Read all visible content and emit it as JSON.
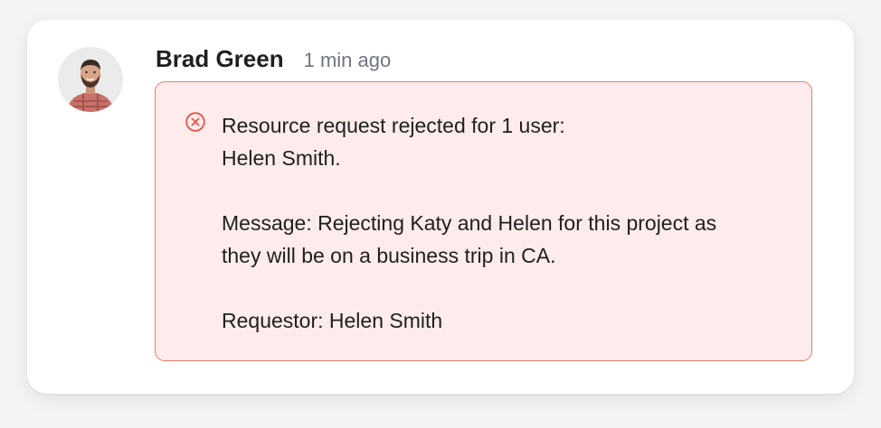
{
  "comment": {
    "author": "Brad Green",
    "time": "1 min ago"
  },
  "alert": {
    "icon": "x-circle-icon",
    "color": "#e5534b",
    "background": "#fdeceb",
    "line1": "Resource request rejected for 1 user:",
    "line2": "Helen Smith.",
    "message_line1": "Message: Rejecting Katy and Helen for this project as",
    "message_line2": "they will be on a business trip in CA.",
    "requestor": "Requestor: Helen Smith"
  }
}
